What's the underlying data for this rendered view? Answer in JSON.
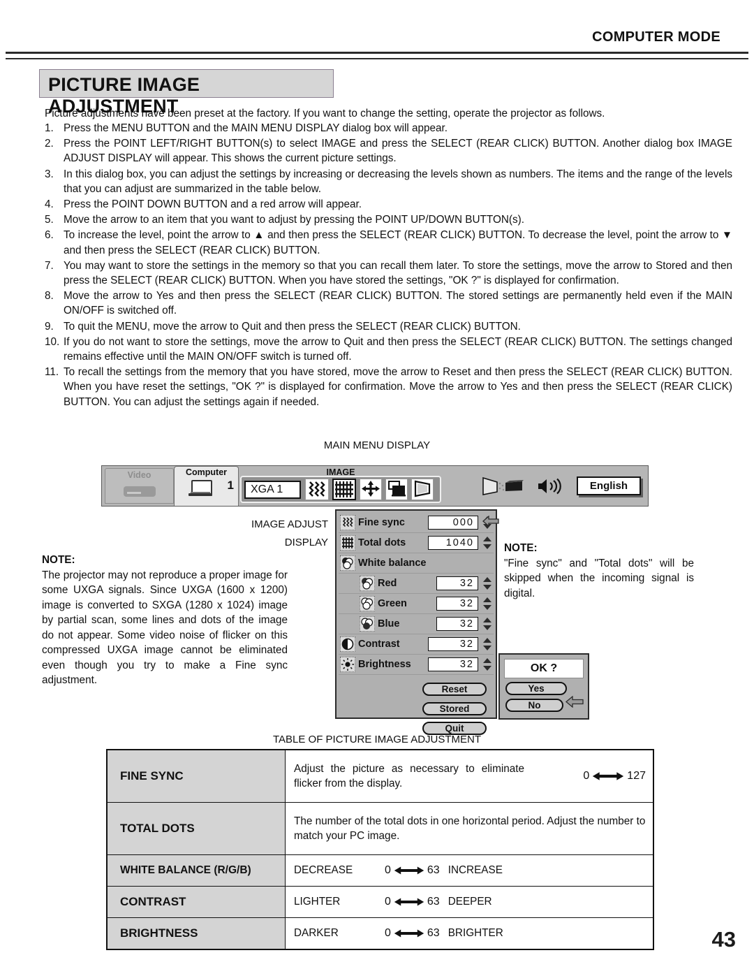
{
  "header": {
    "mode": "COMPUTER MODE",
    "title": "PICTURE IMAGE ADJUSTMENT"
  },
  "intro": "Picture adjustments have been preset at the factory.  If you want to change the setting, operate the projector as follows.",
  "steps": [
    {
      "num": "1.",
      "text": "Press the MENU BUTTON and the MAIN MENU DISPLAY dialog box will appear."
    },
    {
      "num": "2.",
      "text": "Press the POINT LEFT/RIGHT BUTTON(s) to select IMAGE and press the SELECT (REAR CLICK) BUTTON. Another dialog box IMAGE ADJUST DISPLAY will appear. This shows the current picture settings."
    },
    {
      "num": "3.",
      "text": "In this dialog box, you can adjust the settings by increasing or decreasing the levels shown as numbers. The items and the range of the levels that you can adjust are summarized in the table below."
    },
    {
      "num": "4.",
      "text": "Press the POINT DOWN BUTTON and a red arrow will appear."
    },
    {
      "num": "5.",
      "text": "Move the arrow to an item that you want to adjust by pressing the POINT UP/DOWN BUTTON(s)."
    },
    {
      "num": "6.",
      "text": "To increase the level, point the arrow to ▲ and then press the SELECT (REAR CLICK) BUTTON. To decrease the level, point the arrow to ▼ and then press the SELECT (REAR CLICK) BUTTON."
    },
    {
      "num": "7.",
      "text": "You may want to store the settings in the memory so that you can recall them later. To store the settings, move the arrow to Stored and then press the SELECT (REAR CLICK) BUTTON. When you have stored the settings, \"OK ?\" is displayed for confirmation."
    },
    {
      "num": "8.",
      "text": "Move the arrow to Yes and then press the SELECT (REAR CLICK) BUTTON. The stored settings are permanently held even if the MAIN ON/OFF is switched off."
    },
    {
      "num": "9.",
      "text": "To quit the MENU, move the arrow to Quit and then press the SELECT (REAR CLICK) BUTTON."
    },
    {
      "num": "10.",
      "text": "If you do not want to store the settings, move the arrow to Quit and then press the SELECT (REAR CLICK) BUTTON. The settings changed remains effective until the MAIN ON/OFF switch is turned off."
    },
    {
      "num": "11.",
      "text": "To recall the settings from the memory that you have stored, move the arrow to Reset and then press the SELECT (REAR CLICK) BUTTON. When you have reset the settings, \"OK ?\" is displayed for confirmation. Move the arrow to Yes and then press  the SELECT (REAR CLICK) BUTTON. You can adjust the settings again if needed."
    }
  ],
  "captions": {
    "main_menu": "MAIN MENU DISPLAY",
    "image_adjust": "IMAGE ADJUST\nDISPLAY",
    "image_adjust_line1": "IMAGE ADJUST",
    "image_adjust_line2": "DISPLAY",
    "table": "TABLE OF PICTURE IMAGE ADJUSTMENT"
  },
  "main_menu": {
    "video_tab_label": "Video",
    "computer_tab_label": "Computer",
    "computer_number": "1",
    "image_group_label": "IMAGE",
    "source_value": "XGA 1",
    "language_value": "English",
    "icons": [
      {
        "name": "fine-sync-icon",
        "selected": false
      },
      {
        "name": "total-dots-icon",
        "selected": true
      },
      {
        "name": "position-icon",
        "selected": false
      },
      {
        "name": "screen-size-icon",
        "selected": false
      },
      {
        "name": "keystone-icon",
        "selected": false
      }
    ],
    "right_icons": [
      "projection-beam-icon",
      "volume-icon"
    ]
  },
  "image_adjust": {
    "rows": [
      {
        "icon": "fine-sync-icon",
        "label": "Fine sync",
        "value": "000",
        "has_arrow": true
      },
      {
        "icon": "total-dots-icon",
        "label": "Total dots",
        "value": "1040",
        "has_arrow": false
      },
      {
        "icon": "white-balance-icon",
        "label": "White balance",
        "value": "",
        "has_arrow": false
      },
      {
        "icon": "red-icon",
        "label": "Red",
        "value": "32",
        "has_arrow": false
      },
      {
        "icon": "green-icon",
        "label": "Green",
        "value": "32",
        "has_arrow": false
      },
      {
        "icon": "blue-icon",
        "label": "Blue",
        "value": "32",
        "has_arrow": false
      },
      {
        "icon": "contrast-icon",
        "label": "Contrast",
        "value": "32",
        "has_arrow": false
      },
      {
        "icon": "brightness-icon",
        "label": "Brightness",
        "value": "32",
        "has_arrow": false
      }
    ],
    "buttons": [
      "Reset",
      "Stored",
      "Quit"
    ]
  },
  "ok_dialog": {
    "prompt": "OK ?",
    "yes": "Yes",
    "no": "No"
  },
  "note_left": {
    "heading": "NOTE:",
    "body": "The projector may not reproduce a proper image for some UXGA signals. Since UXGA (1600 x 1200) image is converted to SXGA (1280 x 1024) image by partial scan, some lines and dots of the image do not appear. Some video noise of flicker on this compressed UXGA image cannot be eliminated even though you try to make a Fine sync adjustment."
  },
  "note_right": {
    "heading": "NOTE:",
    "body": "\"Fine sync\" and \"Total dots\" will be skipped when the incoming signal is digital."
  },
  "table": {
    "rows": [
      {
        "name": "FINE SYNC",
        "layout": "desc-range",
        "desc": "Adjust the picture as necessary to eliminate flicker from the display.",
        "low": "0",
        "high": "127",
        "left_term": "",
        "right_term": ""
      },
      {
        "name": "TOTAL DOTS",
        "layout": "desc-only",
        "desc": "The number of the total dots in one horizontal period. Adjust the number to match your PC image.",
        "low": "",
        "high": "",
        "left_term": "",
        "right_term": ""
      },
      {
        "name": "WHITE BALANCE (R/G/B)",
        "layout": "terms",
        "desc": "",
        "low": "0",
        "high": "63",
        "left_term": "DECREASE",
        "right_term": "INCREASE"
      },
      {
        "name": "CONTRAST",
        "layout": "terms",
        "desc": "",
        "low": "0",
        "high": "63",
        "left_term": "LIGHTER",
        "right_term": "DEEPER"
      },
      {
        "name": "BRIGHTNESS",
        "layout": "terms",
        "desc": "",
        "low": "0",
        "high": "63",
        "left_term": "DARKER",
        "right_term": "BRIGHTER"
      }
    ]
  },
  "page_number": "43",
  "colors": {
    "plate_fill": "#d6d6d6",
    "dialog_fill": "#b0b0b0",
    "table_header_fill": "#d4d4d4",
    "ink": "#111111"
  }
}
